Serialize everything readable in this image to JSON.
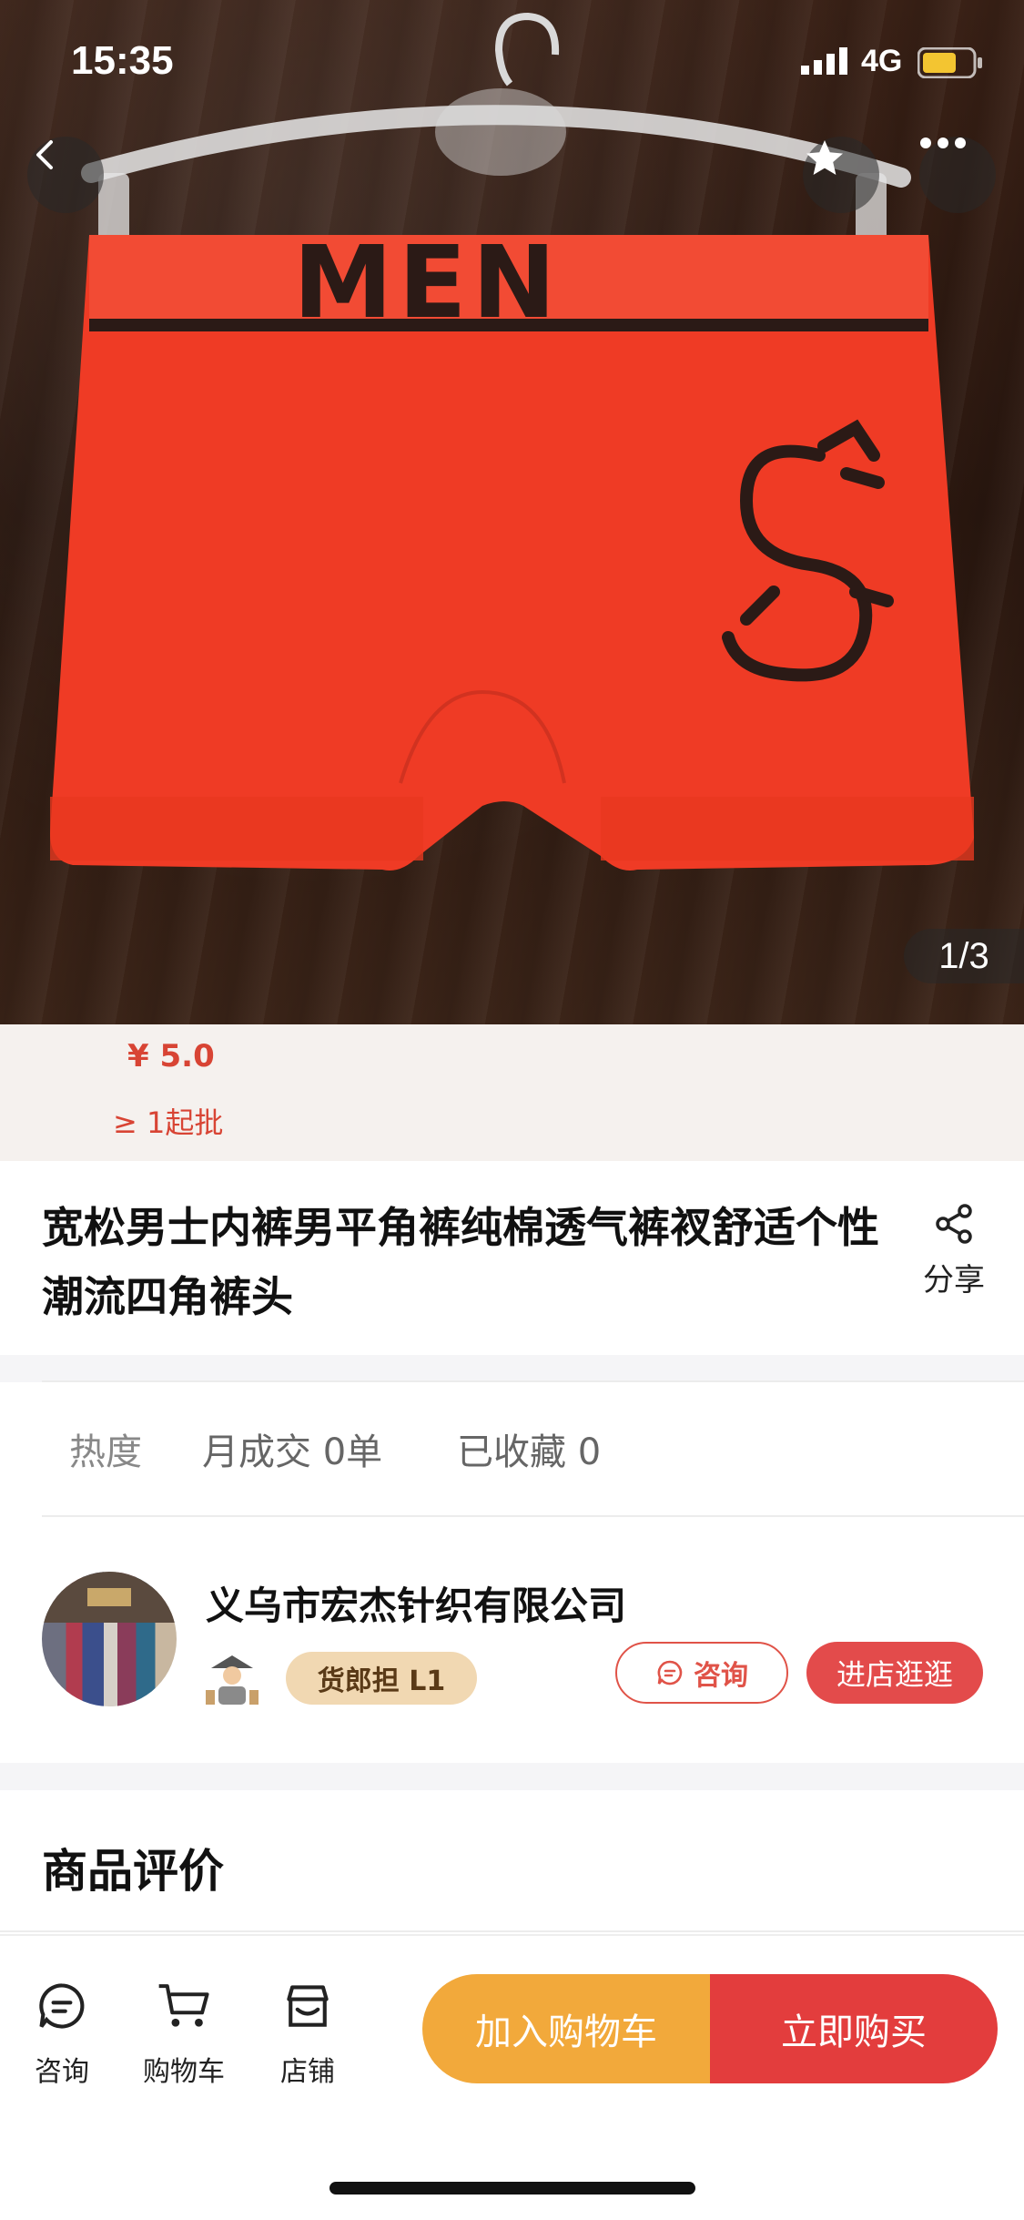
{
  "status_bar": {
    "time": "15:35",
    "network": "4G"
  },
  "gallery": {
    "page_indicator": "1/3",
    "garment_text": "MEN"
  },
  "price": {
    "amount": "¥ 5.0",
    "moq": "≥ 1起批"
  },
  "product": {
    "title": "宽松男士内裤男平角裤纯棉透气裤衩舒适个性潮流四角裤头",
    "share_label": "分享"
  },
  "stats": {
    "heat": "热度",
    "monthly_sales": "月成交 0单",
    "favorites": "已收藏 0"
  },
  "shop": {
    "name": "义乌市宏杰针织有限公司",
    "level": "货郎担 L1",
    "consult_label": "咨询",
    "enter_label": "进店逛逛"
  },
  "reviews": {
    "title": "商品评价"
  },
  "bottom_bar": {
    "tabs": [
      {
        "label": "咨询",
        "icon": "chat-icon"
      },
      {
        "label": "购物车",
        "icon": "cart-icon"
      },
      {
        "label": "店铺",
        "icon": "store-icon"
      }
    ],
    "add_to_cart": "加入购物车",
    "buy_now": "立即购买"
  },
  "colors": {
    "accent": "#e33d3d",
    "cart": "#f2a93b",
    "price": "#d84434"
  }
}
